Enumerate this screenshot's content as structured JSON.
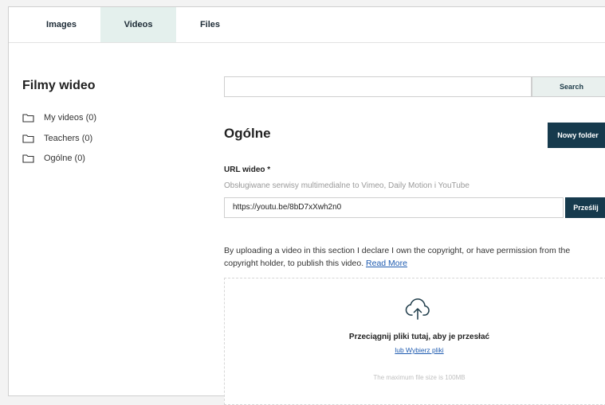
{
  "tabs": [
    {
      "label": "Images",
      "active": false
    },
    {
      "label": "Videos",
      "active": true
    },
    {
      "label": "Files",
      "active": false
    }
  ],
  "sidebar": {
    "title": "Filmy wideo",
    "folders": [
      {
        "label": "My videos (0)",
        "icon": "folder-icon"
      },
      {
        "label": "Teachers (0)",
        "icon": "folder-icon"
      },
      {
        "label": "Ogólne (0)",
        "icon": "folder-icon"
      }
    ]
  },
  "search": {
    "placeholder": "",
    "button_label": "Search"
  },
  "main": {
    "section_title": "Ogólne",
    "new_folder_label": "Nowy folder",
    "url_label": "URL wideo *",
    "url_hint": "Obsługiwane serwisy multimedialne to Vimeo, Daily Motion i YouTube",
    "url_value": "https://youtu.be/8bD7xXwh2n0",
    "send_label": "Prześlij",
    "notice_text": "By uploading a video in this section I declare I own the copyright, or have permission from the copyright holder, to publish this video.",
    "notice_link": "Read More"
  },
  "dropzone": {
    "icon": "cloud-upload-icon",
    "text": "Przeciągnij pliki tutaj, aby je przesłać",
    "link": "lub Wybierz pliki",
    "max_size": "The maximum file size is 100MB"
  },
  "colors": {
    "accent_dark": "#163a4d",
    "active_tab_bg": "#e4f0ed",
    "link": "#1e5bb0"
  }
}
